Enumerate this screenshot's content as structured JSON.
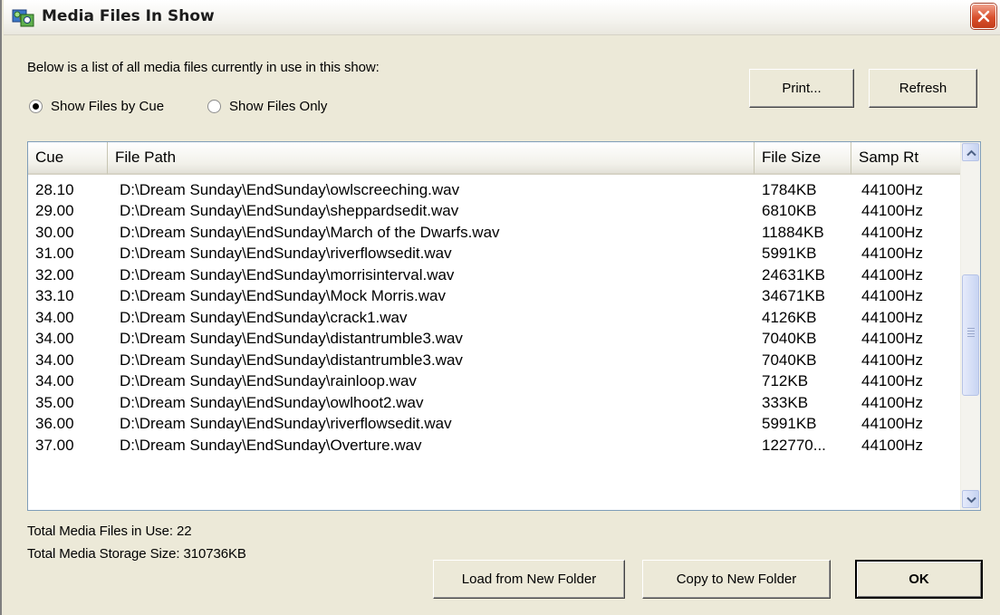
{
  "window": {
    "title": "Media Files In Show"
  },
  "description": "Below is a list of all media files currently in use in this show:",
  "radios": {
    "by_cue": "Show Files by Cue",
    "files_only": "Show Files Only",
    "selected": "by_cue"
  },
  "buttons": {
    "print": "Print...",
    "refresh": "Refresh",
    "load": "Load from New Folder",
    "copy": "Copy to New Folder",
    "ok": "OK"
  },
  "table": {
    "columns": [
      "Cue",
      "File Path",
      "File Size",
      "Samp Rt"
    ],
    "rows": [
      [
        "28.10",
        "D:\\Dream Sunday\\EndSunday\\owlscreeching.wav",
        "1784KB",
        "44100Hz"
      ],
      [
        "29.00",
        "D:\\Dream Sunday\\EndSunday\\sheppardsedit.wav",
        "6810KB",
        "44100Hz"
      ],
      [
        "30.00",
        "D:\\Dream Sunday\\EndSunday\\March of the Dwarfs.wav",
        "11884KB",
        "44100Hz"
      ],
      [
        "31.00",
        "D:\\Dream Sunday\\EndSunday\\riverflowsedit.wav",
        "5991KB",
        "44100Hz"
      ],
      [
        "32.00",
        "D:\\Dream Sunday\\EndSunday\\morrisinterval.wav",
        "24631KB",
        "44100Hz"
      ],
      [
        "33.10",
        "D:\\Dream Sunday\\EndSunday\\Mock Morris.wav",
        "34671KB",
        "44100Hz"
      ],
      [
        "34.00",
        "D:\\Dream Sunday\\EndSunday\\crack1.wav",
        "4126KB",
        "44100Hz"
      ],
      [
        "34.00",
        "D:\\Dream Sunday\\EndSunday\\distantrumble3.wav",
        "7040KB",
        "44100Hz"
      ],
      [
        "34.00",
        "D:\\Dream Sunday\\EndSunday\\distantrumble3.wav",
        "7040KB",
        "44100Hz"
      ],
      [
        "34.00",
        "D:\\Dream Sunday\\EndSunday\\rainloop.wav",
        "712KB",
        "44100Hz"
      ],
      [
        "35.00",
        "D:\\Dream Sunday\\EndSunday\\owlhoot2.wav",
        "333KB",
        "44100Hz"
      ],
      [
        "36.00",
        "D:\\Dream Sunday\\EndSunday\\riverflowsedit.wav",
        "5991KB",
        "44100Hz"
      ],
      [
        "37.00",
        "D:\\Dream Sunday\\EndSunday\\Overture.wav",
        "122770...",
        "44100Hz"
      ]
    ]
  },
  "totals": {
    "files": "Total Media Files in Use: 22",
    "storage": "Total Media Storage Size: 310736KB"
  },
  "icons": {
    "app": "media-files-icon",
    "close": "close-icon",
    "scroll_up": "scroll-up-arrow-icon",
    "scroll_down": "scroll-down-arrow-icon"
  },
  "colors": {
    "dialog_bg": "#ece9d8",
    "close_red": "#d9502d",
    "list_border": "#7f9db9"
  }
}
